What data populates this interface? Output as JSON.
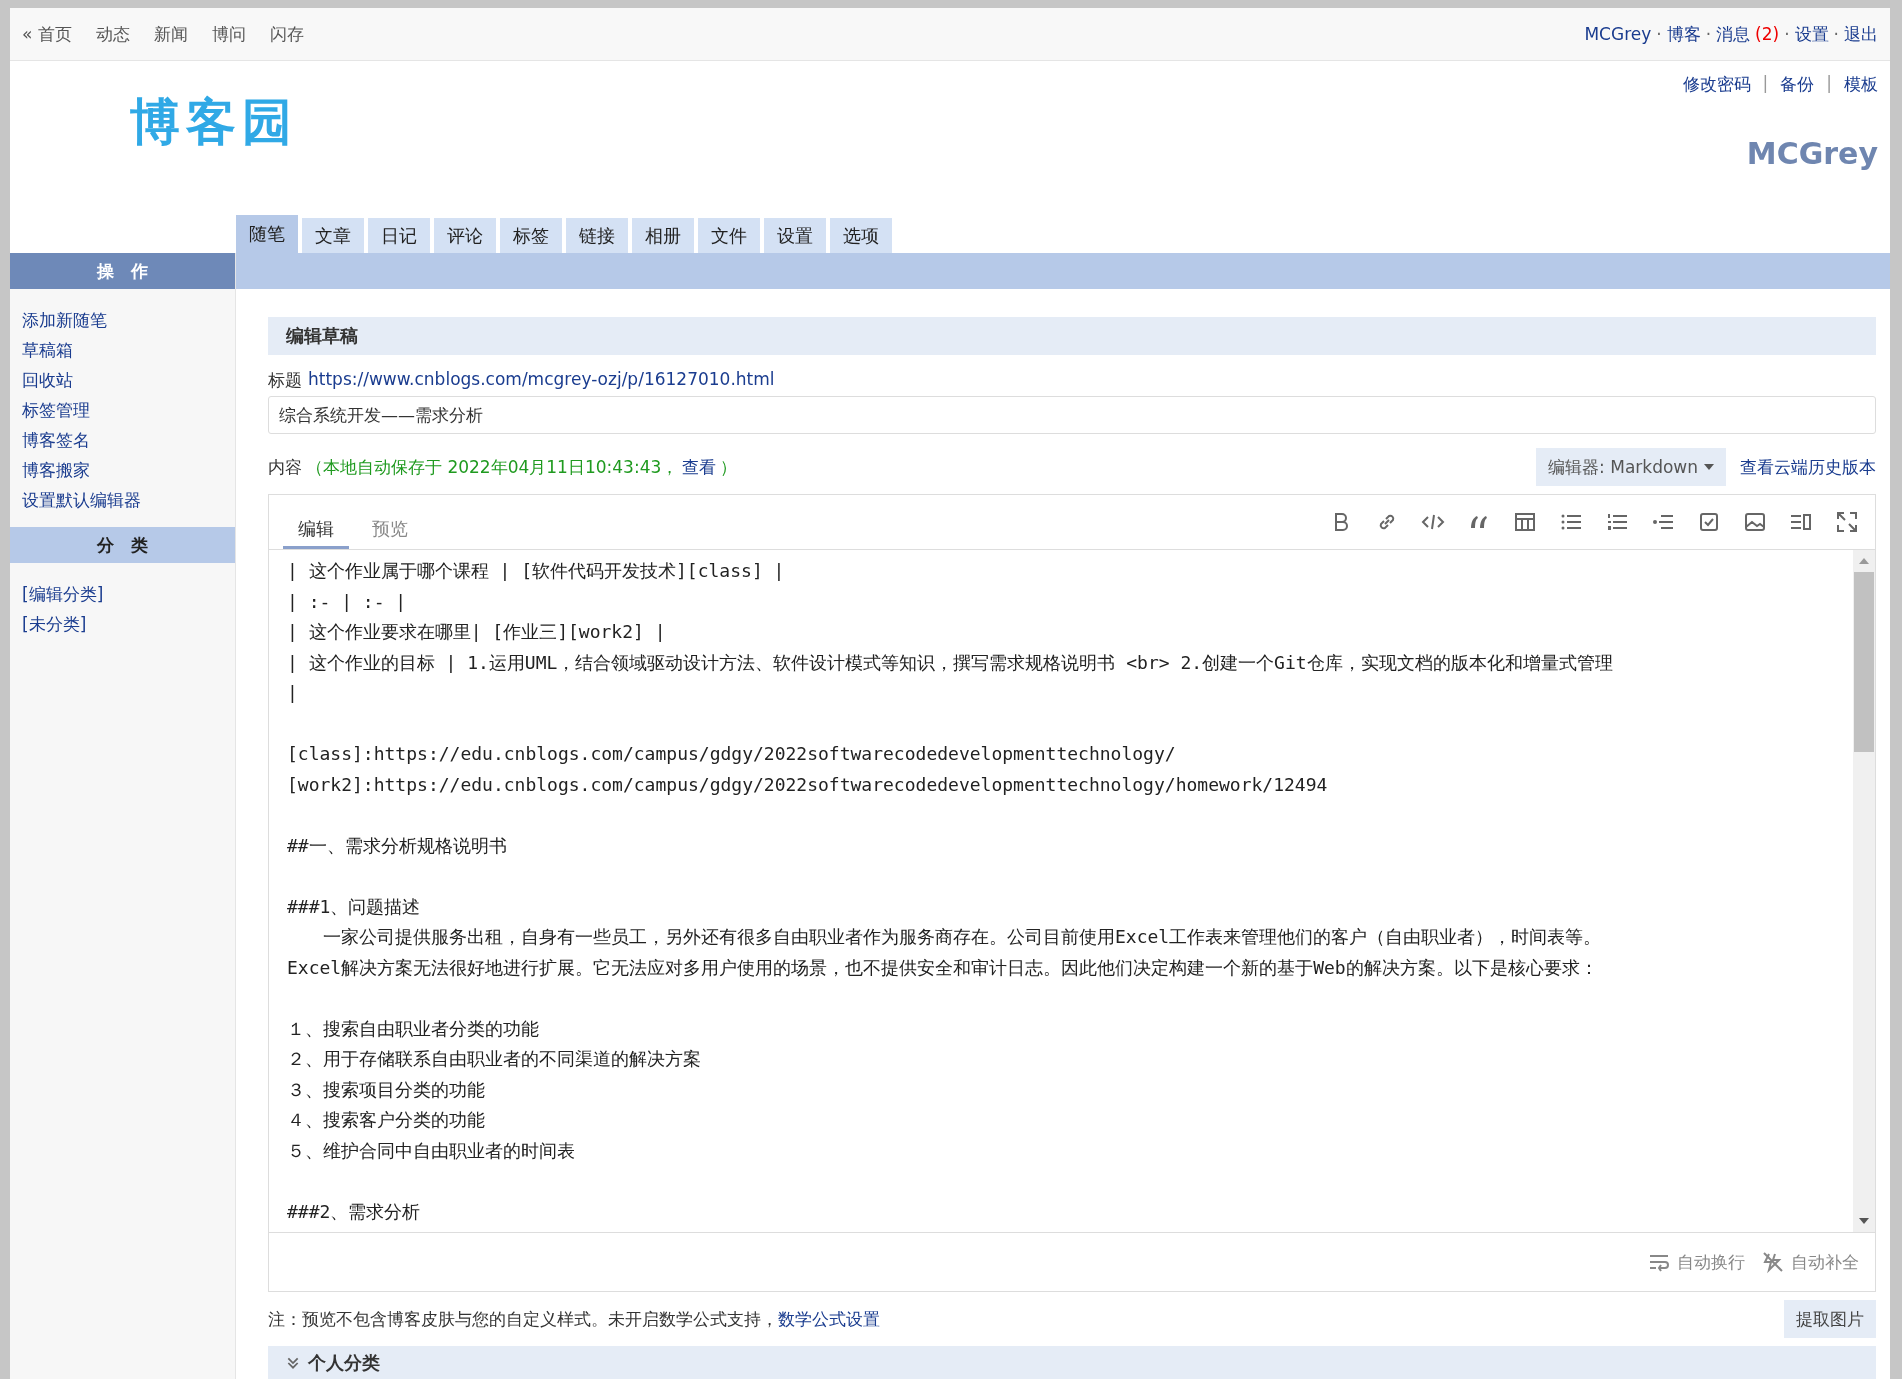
{
  "top_nav": {
    "left": [
      "« 首页",
      "动态",
      "新闻",
      "博问",
      "闪存"
    ],
    "right": [
      {
        "label": "MCGrey"
      },
      {
        "label": "博客"
      },
      {
        "label": "消息",
        "badge": "(2)"
      },
      {
        "label": "设置"
      },
      {
        "label": "退出"
      }
    ],
    "separator": "·"
  },
  "header": {
    "logo": "博客园",
    "links": [
      "修改密码",
      "备份",
      "模板"
    ],
    "link_separator": "|",
    "blog_name": "MCGrey"
  },
  "tabs": [
    {
      "label": "随笔",
      "selected": true
    },
    {
      "label": "文章",
      "selected": false
    },
    {
      "label": "日记",
      "selected": false
    },
    {
      "label": "评论",
      "selected": false
    },
    {
      "label": "标签",
      "selected": false
    },
    {
      "label": "链接",
      "selected": false
    },
    {
      "label": "相册",
      "selected": false
    },
    {
      "label": "文件",
      "selected": false
    },
    {
      "label": "设置",
      "selected": false
    },
    {
      "label": "选项",
      "selected": false
    }
  ],
  "sidebar": {
    "sections": [
      {
        "title": "操　作",
        "kind": "primary",
        "items": [
          "添加新随笔",
          "草稿箱",
          "回收站",
          "标签管理",
          "博客签名",
          "博客搬家",
          "设置默认编辑器"
        ]
      },
      {
        "title": "分　类",
        "kind": "secondary",
        "items": [
          "[编辑分类]",
          "[未分类]"
        ]
      }
    ]
  },
  "main": {
    "section_title": "编辑草稿",
    "title_label": "标题",
    "title_url": "https://www.cnblogs.com/mcgrey-ozj/p/16127010.html",
    "title_value": "综合系统开发——需求分析",
    "content_label": "内容",
    "autosave_text": "（本地自动保存于 2022年04月11日10:43:43，",
    "autosave_link": "查看",
    "autosave_close": "）",
    "editor_selector": "编辑器: Markdown",
    "history_link": "查看云端历史版本",
    "editor_tabs": [
      {
        "label": "编辑",
        "selected": true
      },
      {
        "label": "预览",
        "selected": false
      }
    ],
    "lines": [
      {
        "kind": "text",
        "text": "| 这个作业属于哪个课程 | [软件代码开发技术][class] |"
      },
      {
        "kind": "text",
        "text": "| :- | :- |"
      },
      {
        "kind": "text",
        "text": "| 这个作业要求在哪里| [作业三][work2] |"
      },
      {
        "kind": "text",
        "text": "| 这个作业的目标 | 1.运用UML，结合领域驱动设计方法、软件设计模式等知识，撰写需求规格说明书 <br> 2.创建一个Git仓库，实现文档的版本化和增量式管理"
      },
      {
        "kind": "text",
        "text": "|"
      },
      {
        "kind": "blank"
      },
      {
        "kind": "text",
        "text": "[class]:https://edu.cnblogs.com/campus/gdgy/2022softwarecodedevelopmenttechnology/"
      },
      {
        "kind": "text",
        "text": "[work2]:https://edu.cnblogs.com/campus/gdgy/2022softwarecodedevelopmenttechnology/homework/12494"
      },
      {
        "kind": "blank"
      },
      {
        "kind": "text",
        "text": "##一、需求分析规格说明书"
      },
      {
        "kind": "blank"
      },
      {
        "kind": "text",
        "text": "###1、问题描述"
      },
      {
        "kind": "text",
        "text": "　　一家公司提供服务出租，自身有一些员工，另外还有很多自由职业者作为服务商存在。公司目前使用Excel工作表来管理他们的客户（自由职业者），时间表等。"
      },
      {
        "kind": "text",
        "text": "Excel解决方案无法很好地进行扩展。它无法应对多用户使用的场景，也不提供安全和审计日志。因此他们决定构建一个新的基于Web的解决方案。以下是核心要求："
      },
      {
        "kind": "blank"
      },
      {
        "kind": "text",
        "text": "１、搜索自由职业者分类的功能"
      },
      {
        "kind": "text",
        "text": "２、用于存储联系自由职业者的不同渠道的解决方案"
      },
      {
        "kind": "text",
        "text": "３、搜索项目分类的功能"
      },
      {
        "kind": "text",
        "text": "４、搜索客户分类的功能"
      },
      {
        "kind": "text",
        "text": "５、维护合同中自由职业者的时间表"
      },
      {
        "kind": "blank"
      },
      {
        "kind": "text",
        "text": "###2、需求分析"
      }
    ],
    "footer_toggles": [
      "自动换行",
      "自动补全"
    ],
    "note_text": "注：预览不包含博客皮肤与您的自定义样式。未开启数学公式支持，",
    "note_link": "数学公式设置",
    "extract_button": "提取图片",
    "collapsed_section": "个人分类"
  }
}
